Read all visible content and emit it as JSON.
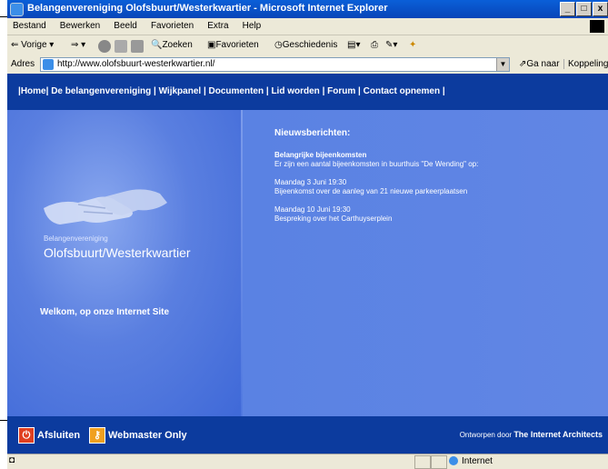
{
  "window": {
    "title": "Belangenvereniging Olofsbuurt/Westerkwartier - Microsoft Internet Explorer",
    "buttons": [
      "_",
      "□",
      "x"
    ]
  },
  "menu": [
    "Bestand",
    "Bewerken",
    "Beeld",
    "Favorieten",
    "Extra",
    "Help"
  ],
  "toolbar": {
    "back": "Vorige",
    "search": "Zoeken",
    "favorites": "Favorieten",
    "history": "Geschiedenis"
  },
  "address": {
    "label": "Adres",
    "url": "http://www.olofsbuurt-westerkwartier.nl/",
    "go": "Ga naar",
    "links": "Koppelingen"
  },
  "nav": {
    "items": [
      "Home",
      "De belangenvereniging",
      "Wijkpanel",
      "Documenten",
      "Lid worden",
      "Forum",
      "Contact opnemen"
    ]
  },
  "left": {
    "org_small": "Belangenvereniging",
    "org_big": "Olofsbuurt/Westerkwartier",
    "welcome": "Welkom, op onze Internet Site"
  },
  "news": {
    "header": "Nieuwsberichten:",
    "sub": "Belangrijke bijeenkomsten",
    "intro": "Er zijn een aantal bijeenkomsten in buurthuis \"De Wending\" op:",
    "event1_date": "Maandag 3 Juni 19:30",
    "event1_text": "Bijeenkomst over de aanleg van 21 nieuwe parkeerplaatsen",
    "event2_date": "Maandag 10 Juni 19:30",
    "event2_text": "Bespreking over het Carthuyserplein"
  },
  "footer": {
    "close": "Afsluiten",
    "webmaster": "Webmaster Only",
    "credit_prefix": "Ontworpen door",
    "credit_name": "The Internet Architects"
  },
  "status": {
    "zone": "Internet"
  }
}
